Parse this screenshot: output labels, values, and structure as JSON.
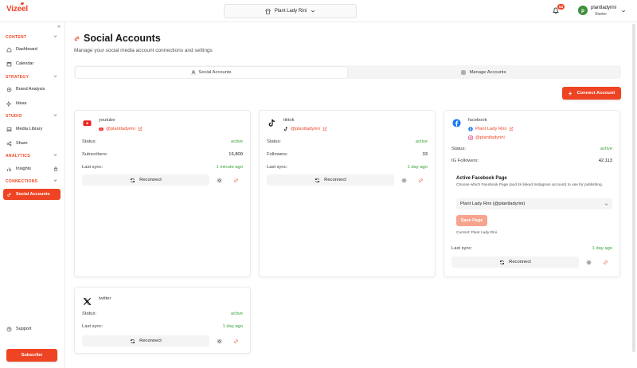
{
  "header": {
    "logo": "Vizeel",
    "brand": "Plant Lady Rini",
    "notification_count": "54",
    "avatar_letter": "p",
    "username": "plantladyrini",
    "plan": "Starter"
  },
  "sidebar": {
    "collapse_icon": "«",
    "sections": {
      "content": "CONTENT",
      "strategy": "STRATEGY",
      "studio": "STUDIO",
      "analytics": "ANALYTICS",
      "connections": "CONNECTIONS"
    },
    "items": {
      "dashboard": "Dashboard",
      "calendar": "Calendar",
      "brand_analysis": "Brand Analysis",
      "ideas": "Ideas",
      "media_library": "Media Library",
      "share": "Share",
      "insights": "Insights",
      "social_accounts": "Social Accounts",
      "support": "Support"
    },
    "subscribe": "Subscribe"
  },
  "page": {
    "title": "Social Accounts",
    "subtitle": "Manage your social media account connections and settings",
    "tabs": [
      "Social Accounts",
      "Manage Accounts"
    ],
    "connect_button": "Connect Account",
    "connect_plus": "+"
  },
  "accounts": {
    "youtube": {
      "platform": "youtube",
      "handle": "@plantladyrini",
      "rows": [
        {
          "label": "Status:",
          "value": "active"
        },
        {
          "label": "Subscribers:",
          "value": "16,800"
        },
        {
          "label": "Last sync:",
          "value": "1 minute ago"
        }
      ],
      "reconnect": "Reconnect"
    },
    "tiktok": {
      "platform": "tiktok",
      "handle": "@plantladyrini",
      "rows": [
        {
          "label": "Status:",
          "value": "active"
        },
        {
          "label": "Followers:",
          "value": "33"
        },
        {
          "label": "Last sync:",
          "value": "1 day ago"
        }
      ],
      "reconnect": "Reconnect"
    },
    "facebook": {
      "platform": "facebook",
      "page_name": "Plant Lady Rini",
      "ig_handle": "@plantladyrini",
      "rows": [
        {
          "label": "Status:",
          "value": "active"
        },
        {
          "label": "IG Followers:",
          "value": "42,113"
        }
      ],
      "active_page_title": "Active Facebook Page",
      "active_page_desc": "Choose which Facebook Page (and its linked Instagram account) to use for publishing.",
      "select_value": "Plant Lady Rini (@plantladyrini)",
      "save_button": "Save Page",
      "current": "Current: Plant Lady Rini",
      "last_sync_label": "Last sync:",
      "last_sync_value": "1 day ago",
      "reconnect": "Reconnect"
    },
    "twitter": {
      "platform": "twitter",
      "rows": [
        {
          "label": "Status:",
          "value": "active"
        },
        {
          "label": "Last sync:",
          "value": "1 day ago"
        }
      ],
      "reconnect": "Reconnect"
    }
  },
  "colors": {
    "accent": "#ef4423",
    "active_green": "#3aa33a",
    "save_disabled": "#f6a48d"
  }
}
